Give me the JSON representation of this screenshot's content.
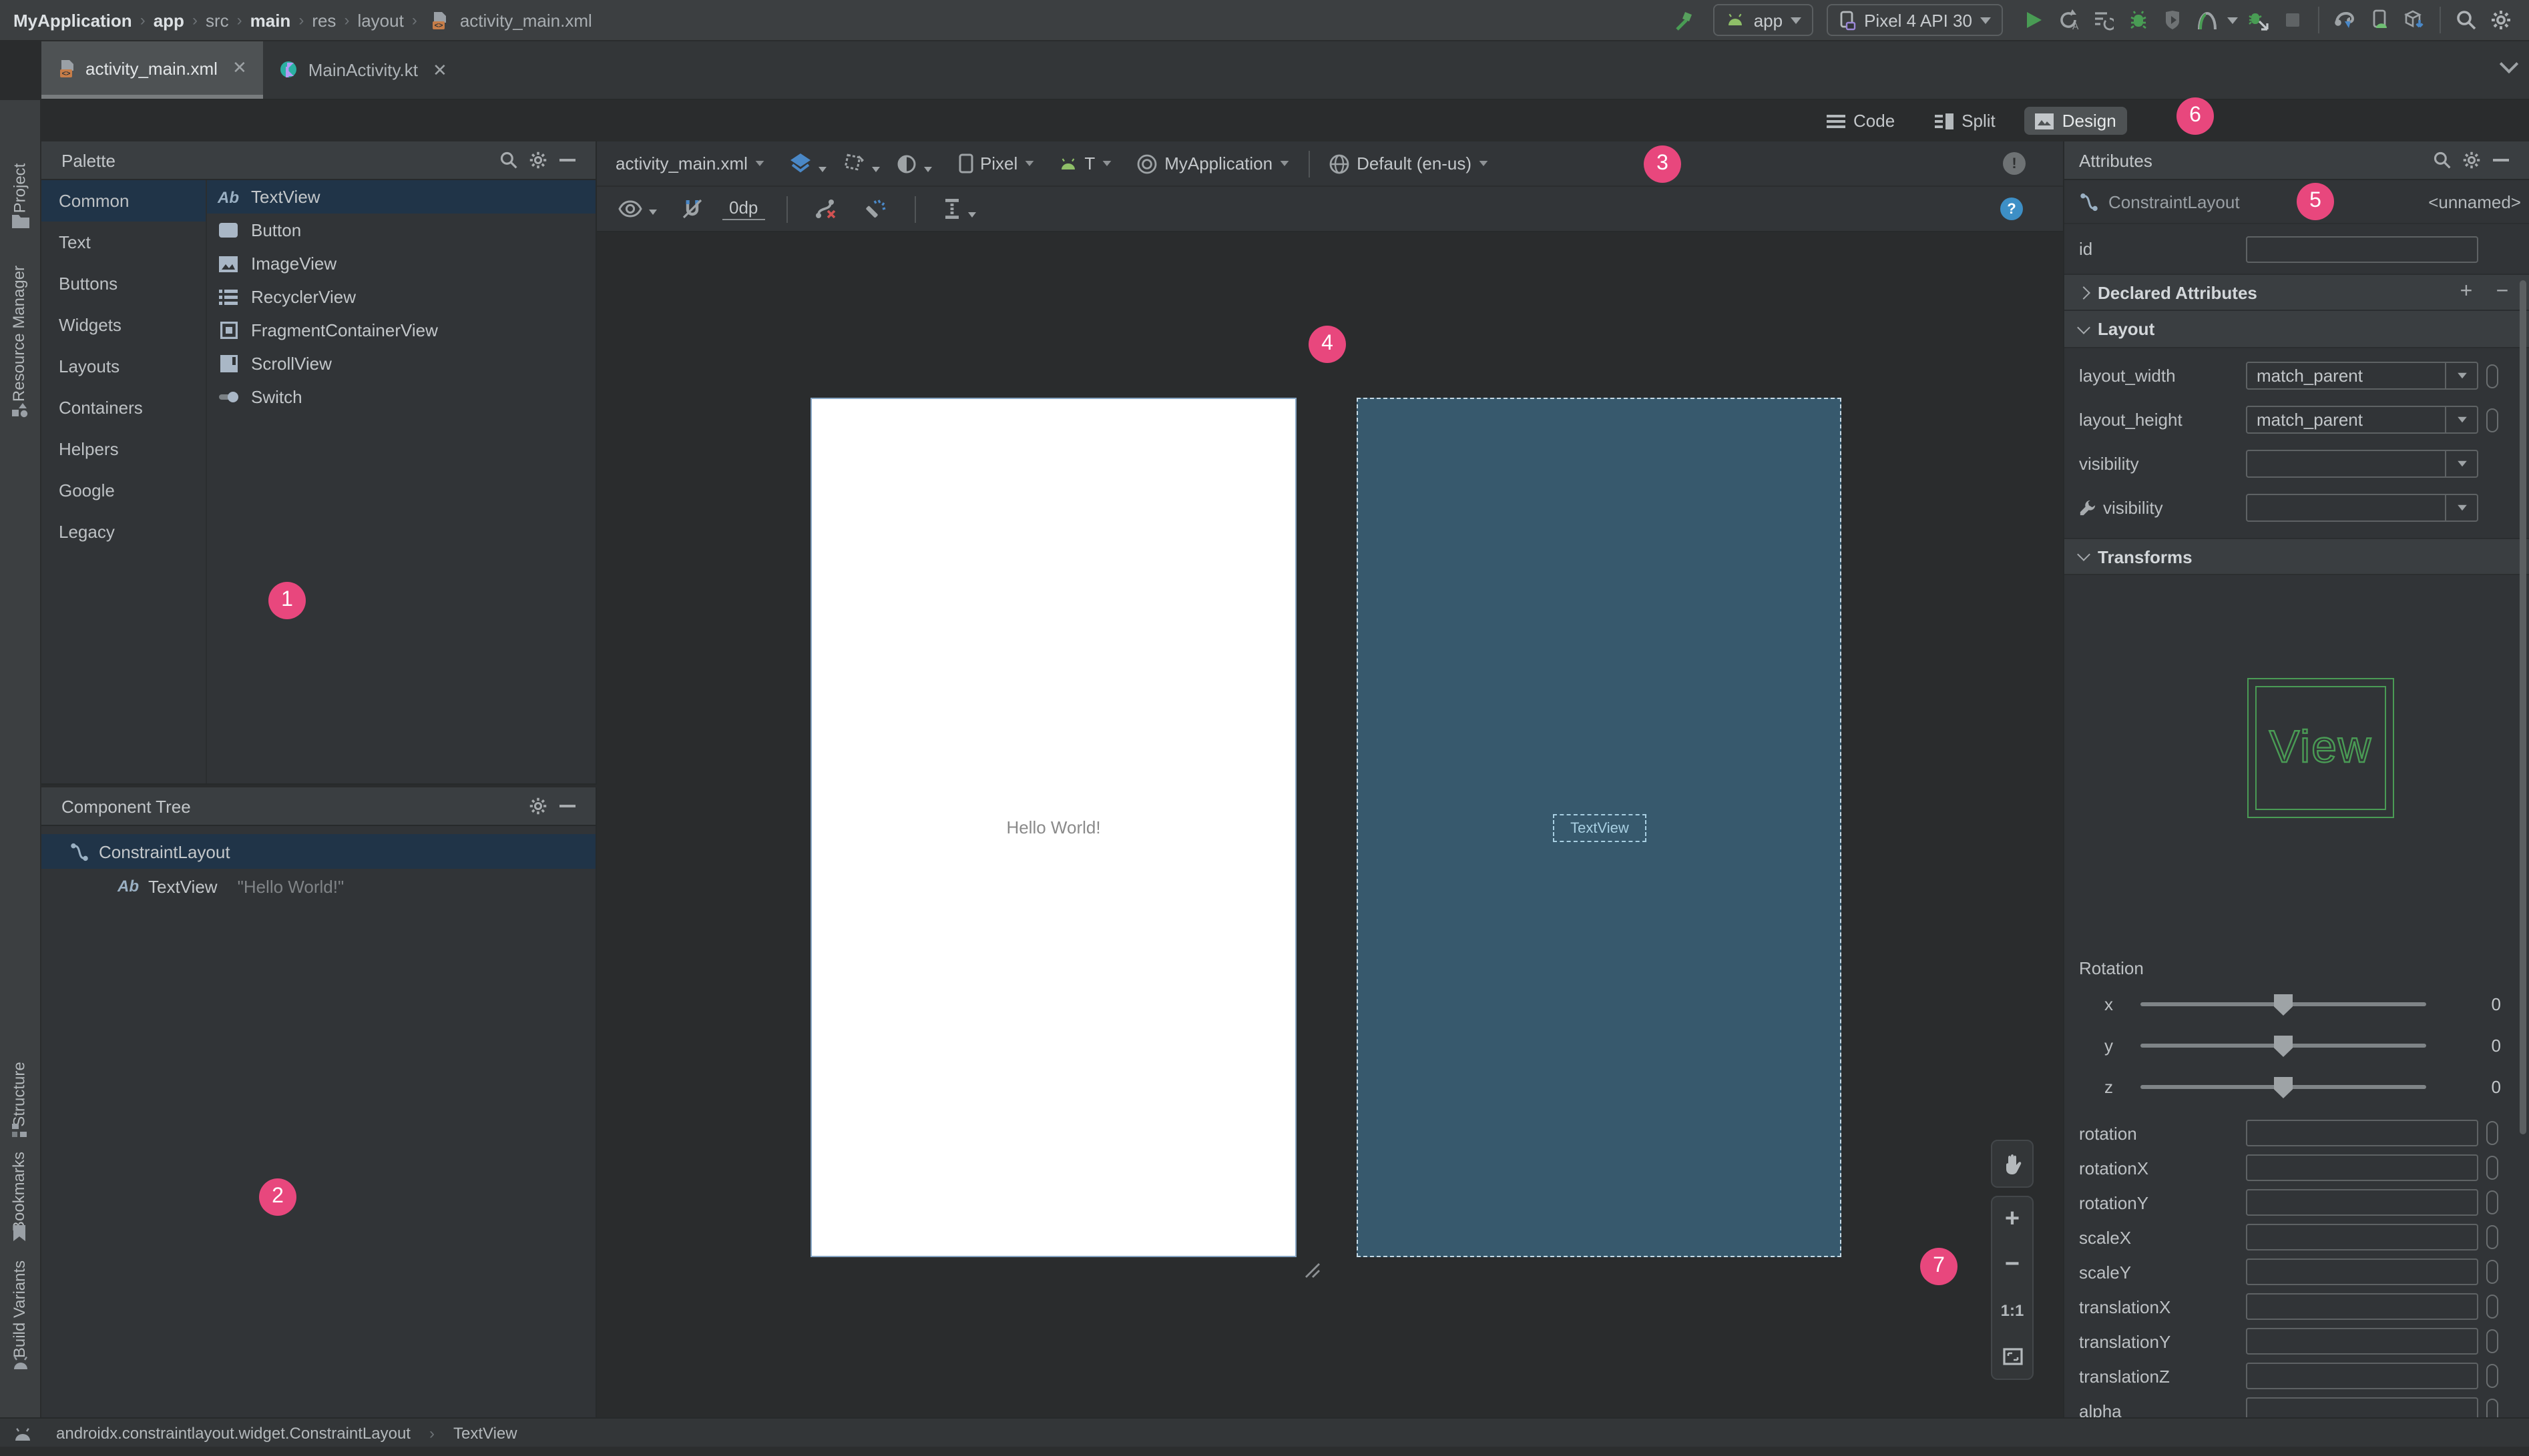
{
  "toolbar": {
    "breadcrumbs": [
      "MyApplication",
      "app",
      "src",
      "main",
      "res",
      "layout",
      "activity_main.xml"
    ],
    "app_config": "app",
    "device": "Pixel 4 API 30"
  },
  "tabs": {
    "tab1": "activity_main.xml",
    "tab2": "MainActivity.kt"
  },
  "view_modes": {
    "code": "Code",
    "split": "Split",
    "design": "Design"
  },
  "stripe": {
    "project": "Project",
    "resource_manager": "Resource Manager",
    "structure": "Structure",
    "bookmarks": "Bookmarks",
    "build_variants": "Build Variants"
  },
  "palette": {
    "title": "Palette",
    "ab": "Ab",
    "categories": [
      "Common",
      "Text",
      "Buttons",
      "Widgets",
      "Layouts",
      "Containers",
      "Helpers",
      "Google",
      "Legacy"
    ],
    "items": [
      "TextView",
      "Button",
      "ImageView",
      "RecyclerView",
      "FragmentContainerView",
      "ScrollView",
      "Switch"
    ]
  },
  "component_tree": {
    "title": "Component Tree",
    "root": "ConstraintLayout",
    "child": "TextView",
    "child_value": "\"Hello World!\""
  },
  "design_toolbar": {
    "file": "activity_main.xml",
    "device": "Pixel",
    "api": "T",
    "theme": "MyApplication",
    "locale": "Default (en-us)",
    "margin": "0dp"
  },
  "canvas": {
    "design_text": "Hello World!",
    "blueprint_label": "TextView",
    "zoom_reset": "1:1"
  },
  "attributes": {
    "title": "Attributes",
    "component": "ConstraintLayout",
    "component_id": "<unnamed>",
    "id_label": "id",
    "sections": {
      "declared": "Declared Attributes",
      "layout": "Layout",
      "transforms": "Transforms"
    },
    "layout_width": {
      "label": "layout_width",
      "value": "match_parent"
    },
    "layout_height": {
      "label": "layout_height",
      "value": "match_parent"
    },
    "visibility_label": "visibility",
    "tools_visibility_label": "visibility",
    "wireframe_text": "View",
    "rotation": {
      "title": "Rotation",
      "x_label": "x",
      "x_value": "0",
      "y_label": "y",
      "y_value": "0",
      "z_label": "z",
      "z_value": "0"
    },
    "fields": [
      "rotation",
      "rotationX",
      "rotationY",
      "scaleX",
      "scaleY",
      "translationX",
      "translationY",
      "translationZ",
      "alpha"
    ]
  },
  "status": {
    "class_path": "androidx.constraintlayout.widget.ConstraintLayout",
    "selected": "TextView"
  },
  "badges": [
    "1",
    "2",
    "3",
    "4",
    "5",
    "6",
    "7"
  ],
  "colors": {
    "accent": "#e8477d",
    "blueprint": "#37596d",
    "wireframe_green": "#4a9b55",
    "run_green": "#499c54",
    "help_blue": "#3d8fc6"
  }
}
